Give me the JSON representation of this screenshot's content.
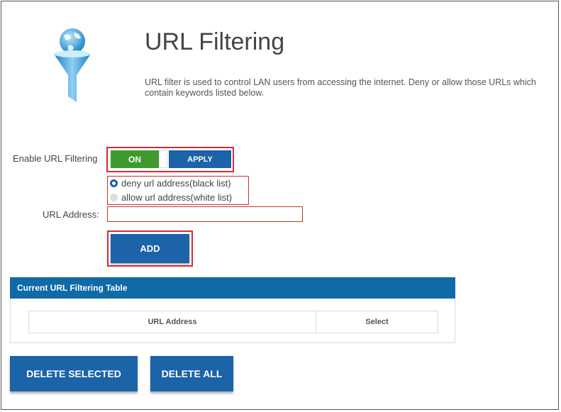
{
  "header": {
    "title": "URL Filtering",
    "description": "URL filter is used to control LAN users from accessing the internet. Deny or allow those URLs which contain keywords listed below.",
    "logo_icon": "globe-funnel-icon"
  },
  "enable": {
    "label": "Enable URL Filtering",
    "toggle_state": "ON",
    "apply_label": "APPLY"
  },
  "mode": {
    "options": [
      {
        "label": "deny url address(black list)",
        "checked": true
      },
      {
        "label": "allow url address(white list)",
        "checked": false
      }
    ]
  },
  "url_address": {
    "label": "URL Address:",
    "value": "",
    "placeholder": ""
  },
  "add_label": "ADD",
  "table": {
    "title": "Current URL Filtering Table",
    "columns": [
      "URL Address",
      "Select"
    ],
    "rows": []
  },
  "actions": {
    "delete_selected_label": "DELETE SELECTED",
    "delete_all_label": "DELETE ALL"
  },
  "colors": {
    "accent": "#1c63a8",
    "on_green": "#3f9a2e",
    "highlight_red": "#d12c35",
    "table_header": "#0f6aa6"
  }
}
